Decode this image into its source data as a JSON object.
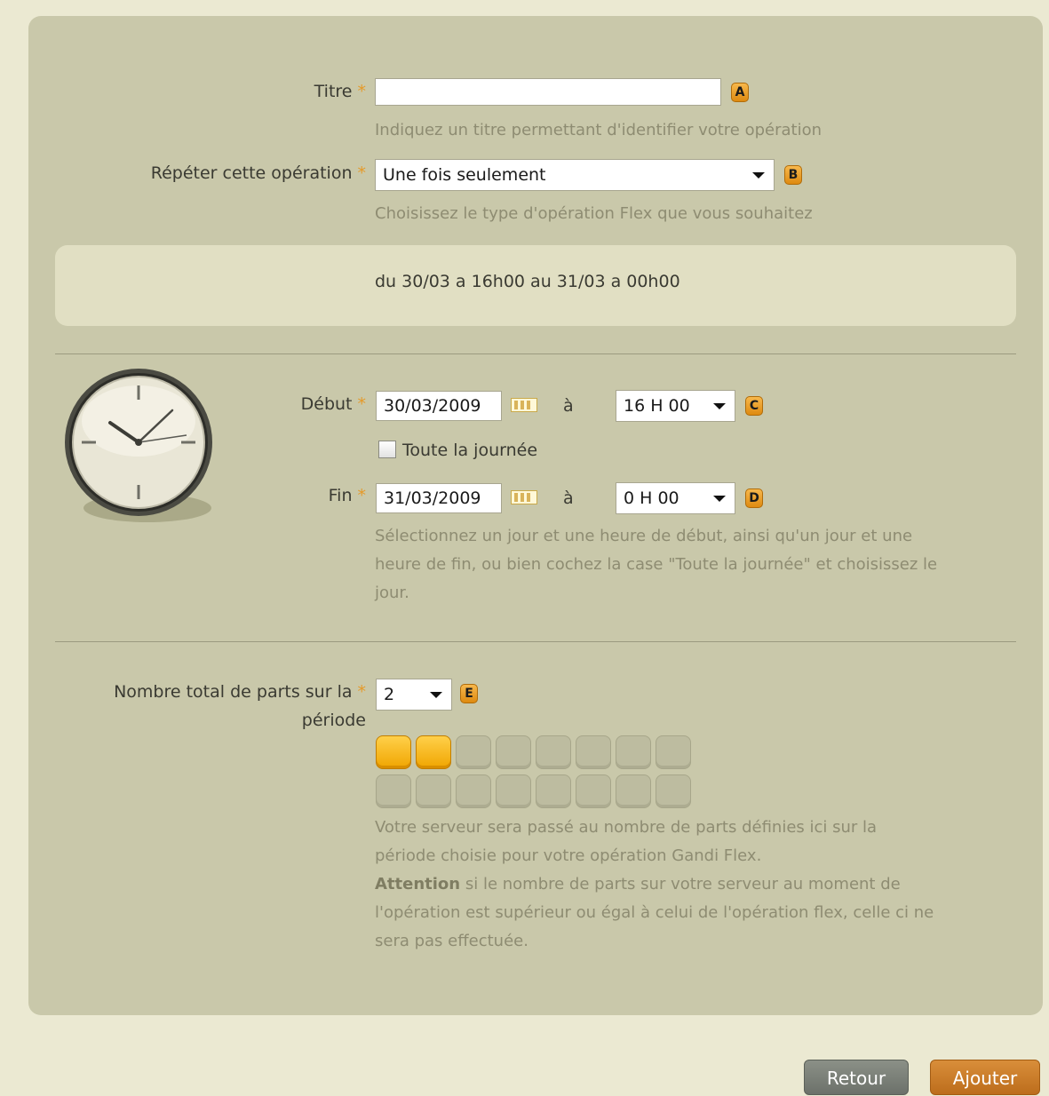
{
  "colors": {
    "page_background": "#ebe9d2",
    "panel_background": "#c9c8aa",
    "accent_orange": "#e59a2a",
    "help_text": "#8e8c72"
  },
  "form": {
    "required_marker": "*",
    "title": {
      "label": "Titre",
      "value": "",
      "badge": "A",
      "help": "Indiquez un titre permettant d'identifier votre opération"
    },
    "repeat": {
      "label": "Répéter cette opération",
      "selected": "Une fois seulement",
      "badge": "B",
      "help": "Choisissez le type d'opération Flex que vous souhaitez"
    },
    "summary": "du 30/03 a 16h00 au 31/03 a 00h00",
    "start": {
      "label": "Début",
      "date": "30/03/2009",
      "at_label": "à",
      "time": "16 H 00",
      "badge": "C"
    },
    "all_day": {
      "label": "Toute la journée",
      "checked": false
    },
    "end": {
      "label": "Fin",
      "date": "31/03/2009",
      "at_label": "à",
      "time": "0 H 00",
      "badge": "D"
    },
    "schedule_help": [
      "Sélectionnez un jour et une heure de début, ainsi qu'un jour et une",
      "heure de fin, ou bien cochez la case \"Toute la journée\" et choisissez le",
      "jour."
    ],
    "parts": {
      "label_line1": "Nombre total de parts sur la",
      "label_line2": "période",
      "selected": "2",
      "badge": "E",
      "selected_count": 2,
      "total_count": 16
    },
    "parts_help": [
      "Votre serveur sera passé au nombre de parts définies ici sur la",
      "période choisie pour votre opération Gandi Flex."
    ],
    "attention": {
      "bold": "Attention",
      "line1_rest": " si le nombre de parts sur votre serveur au moment de",
      "line2": "l'opération est supérieur ou égal à celui de l'opération flex, celle ci ne",
      "line3": "sera pas effectuée."
    }
  },
  "buttons": {
    "back": "Retour",
    "add": "Ajouter"
  },
  "icons": {
    "clock": "clock-icon",
    "calendar": "calendar-icon",
    "dropdown": "chevron-down-icon",
    "checkbox": "checkbox"
  }
}
